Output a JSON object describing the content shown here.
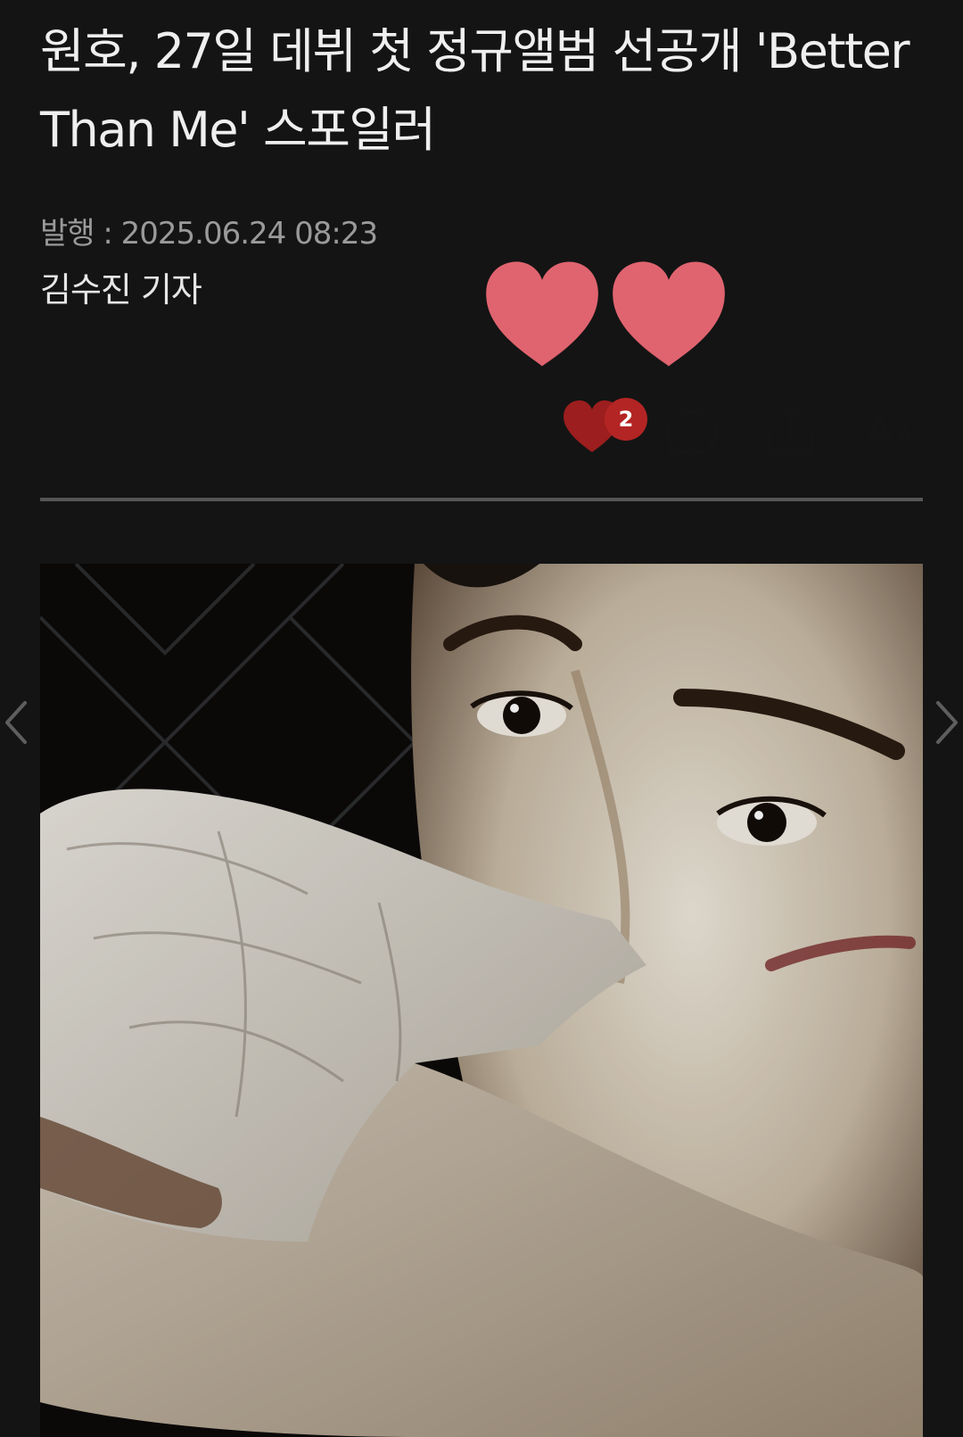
{
  "article": {
    "headline": "원호, 27일 데뷔 첫 정규앨범 선공개 'Better Than Me' 스포일러",
    "published": "발행 : 2025.06.24 08:23",
    "reporter": "김수진 기자"
  },
  "toolbar": {
    "like_count": "2",
    "icons": [
      "heart-icon",
      "comment-icon",
      "share-icon",
      "font-size-icon"
    ],
    "like_color": "#b32524"
  },
  "floating_hearts": {
    "color": "#e06470",
    "count": 2
  },
  "gallery": {
    "image": "photo-portrait",
    "nav": [
      "chevron-left-icon",
      "chevron-right-icon"
    ]
  }
}
